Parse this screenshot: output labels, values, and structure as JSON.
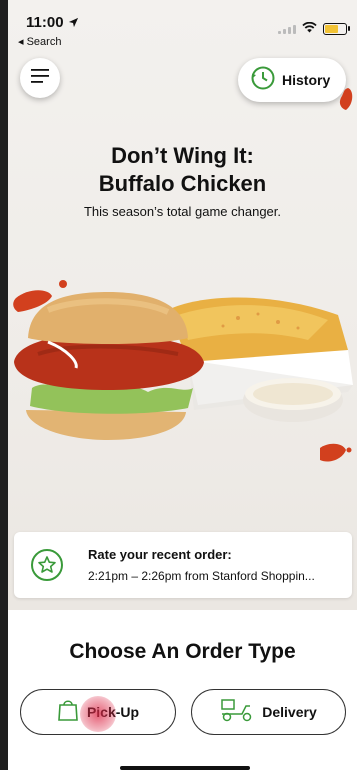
{
  "status_bar": {
    "time": "11:00",
    "back_label": "◂ Search"
  },
  "header": {
    "history_label": "History"
  },
  "promo": {
    "title_line1": "Don’t Wing It:",
    "title_line2": "Buffalo Chicken",
    "subtitle": "This season’s total game changer."
  },
  "rate_order": {
    "title": "Rate your recent order:",
    "detail": "2:21pm – 2:26pm from Stanford Shoppin..."
  },
  "order_type": {
    "heading": "Choose An Order Type",
    "pickup_label": "Pick-Up",
    "delivery_label": "Delivery"
  },
  "colors": {
    "accent_green": "#3a9a3a",
    "splash_red": "#d2401e"
  },
  "icons": [
    "location-arrow-icon",
    "signal-icon",
    "wifi-icon",
    "battery-icon",
    "menu-icon",
    "history-clock-icon",
    "star-icon",
    "shopping-bag-icon",
    "scooter-icon"
  ]
}
